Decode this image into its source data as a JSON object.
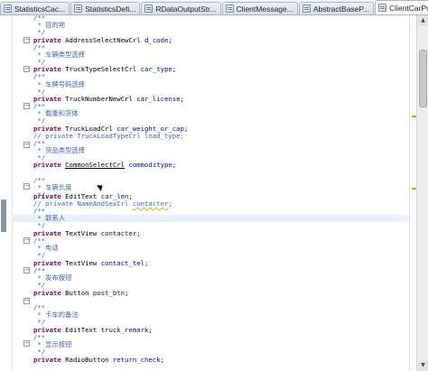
{
  "tabs": [
    {
      "label": "StatisticsCac...",
      "active": false
    },
    {
      "label": "StatisticsDefi...",
      "active": false
    },
    {
      "label": "RDataOutputStr...",
      "active": false
    },
    {
      "label": "ClientMessage...",
      "active": false
    },
    {
      "label": "AbstractBaseP...",
      "active": false
    },
    {
      "label": "ClientCarPubli...",
      "active": true
    }
  ],
  "code": {
    "l0": {
      "c1": "/**"
    },
    "l1": {
      "c1": " * 目的地"
    },
    "l2": {
      "c1": " */"
    },
    "l3": {
      "k1": "private ",
      "t1": "AddressSelectNewCrl ",
      "f1": "d_code",
      "t2": ";"
    },
    "l4": {
      "c1": "/**"
    },
    "l5": {
      "c1": " * 车辆类型选择"
    },
    "l6": {
      "c1": " */"
    },
    "l7": {
      "k1": "private ",
      "t1": "TruckTypeSelectCrl ",
      "f1": "car_type",
      "t2": ";"
    },
    "l8": {
      "c1": "/**"
    },
    "l9": {
      "c1": " * 车牌号码选择"
    },
    "l10": {
      "c1": " */"
    },
    "l11": {
      "k1": "private ",
      "t1": "TruckNumberNewCrl ",
      "f1": "car_license",
      "t2": ";"
    },
    "l12": {
      "c1": "/**"
    },
    "l13": {
      "c1": " * 载重和货体"
    },
    "l14": {
      "c1": " */"
    },
    "l15": {
      "k1": "private ",
      "t1": "TruckLoadCrl ",
      "f1": "car_weight_or_cap",
      "t2": ";"
    },
    "l16": {
      "c1": "// private TruckLoadTypeCrl load_type;"
    },
    "l17": {
      "c1": "/**"
    },
    "l18": {
      "c1": " * 货品类型选择"
    },
    "l19": {
      "c1": " */"
    },
    "l20": {
      "k1": "private ",
      "t1": "CommonSelectCrl",
      "t2": " ",
      "f1": "commoditype",
      "t3": ";"
    },
    "l21": {
      "c1": "/**"
    },
    "l22": {
      "c1": " * 车辆长度"
    },
    "l23": {
      "c1": " */"
    },
    "l24": {
      "k1": "private ",
      "t1": "EditText ",
      "f1": "car_len",
      "t2": ";"
    },
    "l25": {
      "c1": "// private NameAndSexCrl ",
      "c2": "contacter",
      "c3": ";"
    },
    "l26": {
      "c1": "/**"
    },
    "l27": {
      "c1": " * 联系人"
    },
    "l28": {
      "c1": " */"
    },
    "l29": {
      "k1": "private ",
      "t1": "TextView ",
      "f1": "contacter",
      "t2": ";"
    },
    "l30": {
      "c1": "/**"
    },
    "l31": {
      "c1": " * 电话"
    },
    "l32": {
      "c1": " */"
    },
    "l33": {
      "k1": "private ",
      "t1": "TextView ",
      "f1": "contact_tel",
      "t2": ";"
    },
    "l34": {
      "c1": "/**"
    },
    "l35": {
      "c1": " * 发布按钮"
    },
    "l36": {
      "c1": " */"
    },
    "l37": {
      "k1": "private ",
      "t1": "Button ",
      "f1": "post_btn",
      "t2": ";"
    },
    "l38": {
      "c1": "/**"
    },
    "l39": {
      "c1": " * 卡车的备注"
    },
    "l40": {
      "c1": " */"
    },
    "l41": {
      "k1": "private ",
      "t1": "EditText ",
      "f1": "truck_remark",
      "t2": ";"
    },
    "l42": {
      "c1": "/**"
    },
    "l43": {
      "c1": " * 显示按钮"
    },
    "l44": {
      "c1": " */"
    },
    "l45": {
      "k1": "private ",
      "t1": "RadioButton ",
      "f1": "return_check",
      "t2": ";"
    }
  },
  "icons": {
    "tab": "java-file-icon",
    "fold": "fold-collapse-icon",
    "cursor": "mouse-pointer-icon",
    "scroll_up": "arrow-up-icon",
    "scroll_down": "arrow-down-icon"
  },
  "colors": {
    "keyword": "#7f0055",
    "comment": "#3f5fbf",
    "field": "#0000c0",
    "current_line": "#e8f2fe"
  }
}
